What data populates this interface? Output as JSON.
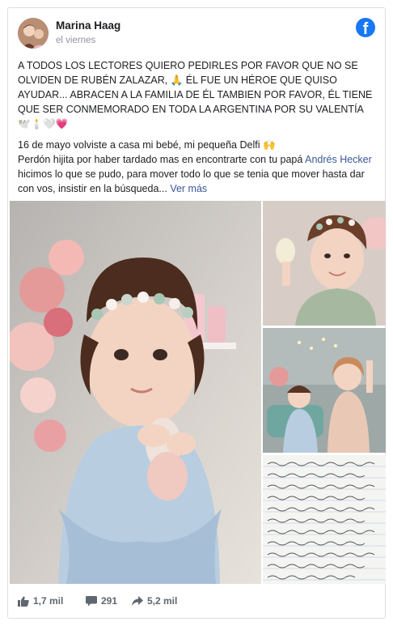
{
  "post": {
    "author": "Marina Haag",
    "date": "el viernes",
    "paragraph1": "A TODOS LOS LECTORES QUIERO PEDIRLES POR FAVOR QUE NO SE OLVIDEN DE RUBÉN ZALAZAR, 🙏 ÉL FUE UN HÉROE QUE QUISO AYUDAR... ABRACEN A LA FAMILIA DE ÉL TAMBIEN POR FAVOR, ÉL TIENE QUE SER CONMEMORADO EN TODA LA ARGENTINA POR SU VALENTÍA 🕊️🕯️🤍💗",
    "line1": "16 de mayo volviste a casa mi bebé, mi pequeña Delfi 🙌",
    "line2_before": "Perdón hijita por haber tardado mas en encontrarte con tu papá ",
    "mention": "Andrés Hecker",
    "line2_after": " hicimos lo que se pudo, para mover todo lo que se tenia que mover hasta dar con vos, insistir en la búsqueda...",
    "see_more": "Ver más"
  },
  "stats": {
    "likes": "1,7 mil",
    "comments": "291",
    "shares": "5,2 mil"
  },
  "icons": {
    "brand": "facebook-logo-icon",
    "likes": "thumbs-up-icon",
    "comments": "comment-icon",
    "shares": "share-arrow-icon"
  },
  "colors": {
    "brand": "#1877f2",
    "link": "#385898",
    "meta": "#90949c",
    "footer": "#606770"
  }
}
